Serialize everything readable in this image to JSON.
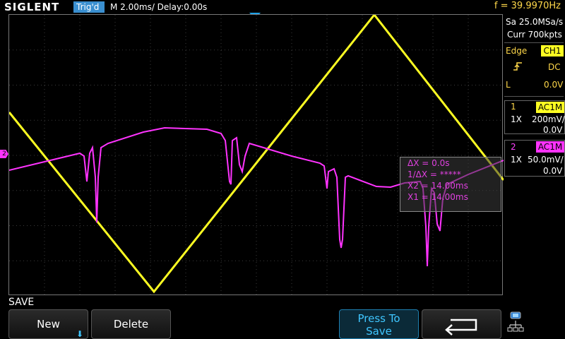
{
  "topbar": {
    "brand": "SIGLENT",
    "trigger_status": "Trig'd",
    "timebase": "M 2.00ms/ Delay:0.00s",
    "frequency": "f = 39.9970Hz"
  },
  "right_panel": {
    "sample_rate": "Sa 25.0MSa/s",
    "memory_depth": "Curr 700kpts",
    "trigger": {
      "type": "Edge",
      "source": "CH1",
      "coupling": "DC",
      "level_label": "L",
      "level_value": "0.0V"
    },
    "ch1": {
      "number": "1",
      "coupling": "AC1M",
      "probe": "1X",
      "scale": "200mV/",
      "offset": "0.0V"
    },
    "ch2": {
      "number": "2",
      "coupling": "AC1M",
      "probe": "1X",
      "scale": "50.0mV/",
      "offset": "0.0V"
    }
  },
  "cursor_measure": {
    "delta_x": "ΔX = 0.0s",
    "inv_delta_x": "1/ΔX = *****",
    "x2": "X2 = 14.00ms",
    "x1": "X1 = 14.00ms"
  },
  "menu": {
    "title": "SAVE",
    "new_label": "New",
    "delete_label": "Delete",
    "press_line1": "Press To",
    "press_line2": "Save"
  },
  "colors": {
    "ch1": "#ffff22",
    "ch2": "#ff33ff",
    "accent": "#3fc6ff",
    "grid": "#3c3c3c"
  },
  "icons": {
    "trigger_edge": "rising-edge-icon",
    "back": "return-arrow-icon",
    "network": "network-icon",
    "dropdown": "arrow-down-icon"
  }
}
